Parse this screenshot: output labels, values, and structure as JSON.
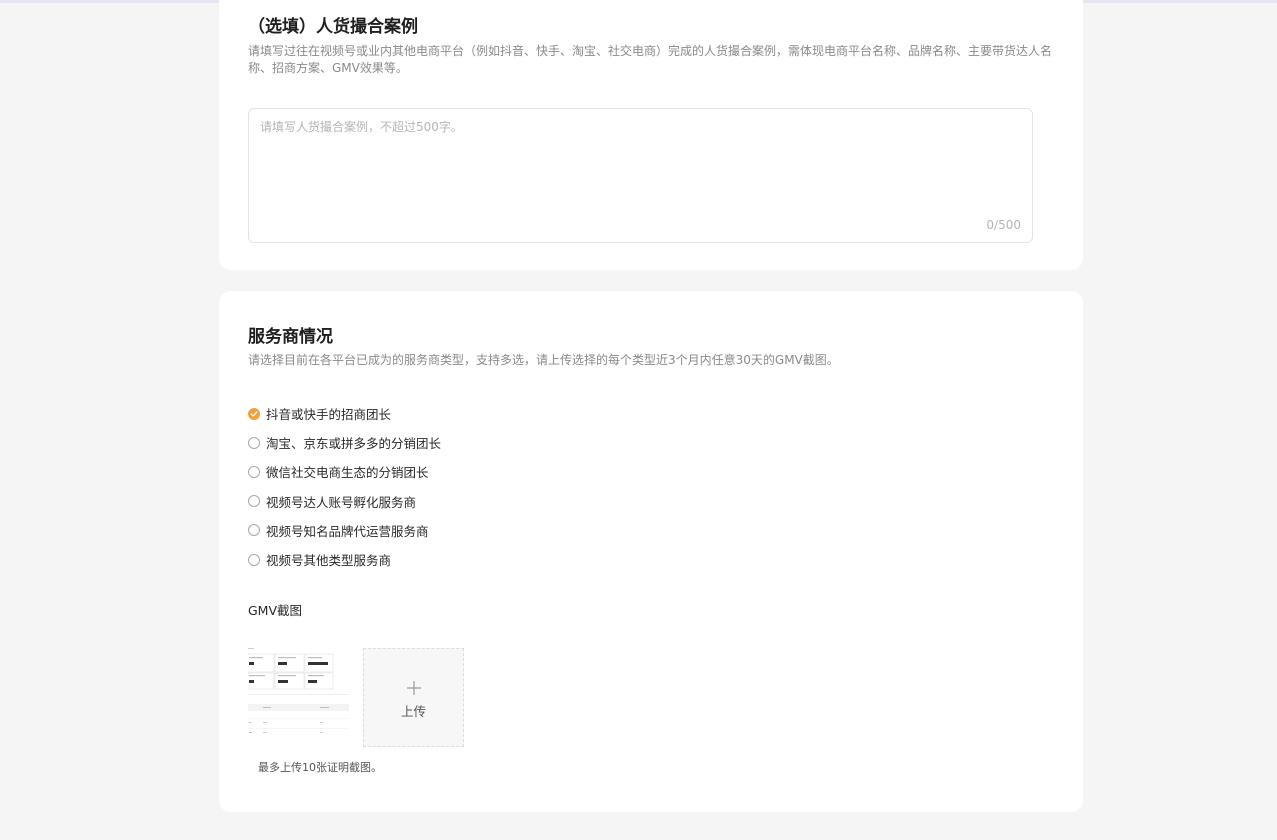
{
  "case_section": {
    "title": "（选填）人货撮合案例",
    "description": "请填写过往在视频号或业内其他电商平台（例如抖音、快手、淘宝、社交电商）完成的人货撮合案例，需体现电商平台名称、品牌名称、主要带货达人名称、招商方案、GMV效果等。",
    "textarea_placeholder": "请填写人货撮合案例，不超过500字。",
    "textarea_value": "",
    "char_count": "0/500"
  },
  "provider_section": {
    "title": "服务商情况",
    "description": "请选择目前在各平台已成为的服务商类型，支持多选，请上传选择的每个类型近3个月内任意30天的GMV截图。",
    "options": [
      {
        "label": "抖音或快手的招商团长",
        "checked": true
      },
      {
        "label": "淘宝、京东或拼多多的分销团长",
        "checked": false
      },
      {
        "label": "微信社交电商生态的分销团长",
        "checked": false
      },
      {
        "label": "视频号达人账号孵化服务商",
        "checked": false
      },
      {
        "label": "视频号知名品牌代运营服务商",
        "checked": false
      },
      {
        "label": "视频号其他类型服务商",
        "checked": false
      }
    ],
    "gmv_label": "GMV截图",
    "upload_label": "上传",
    "upload_hint": "最多上传10张证明截图。",
    "check_color": "#f0a33c"
  }
}
